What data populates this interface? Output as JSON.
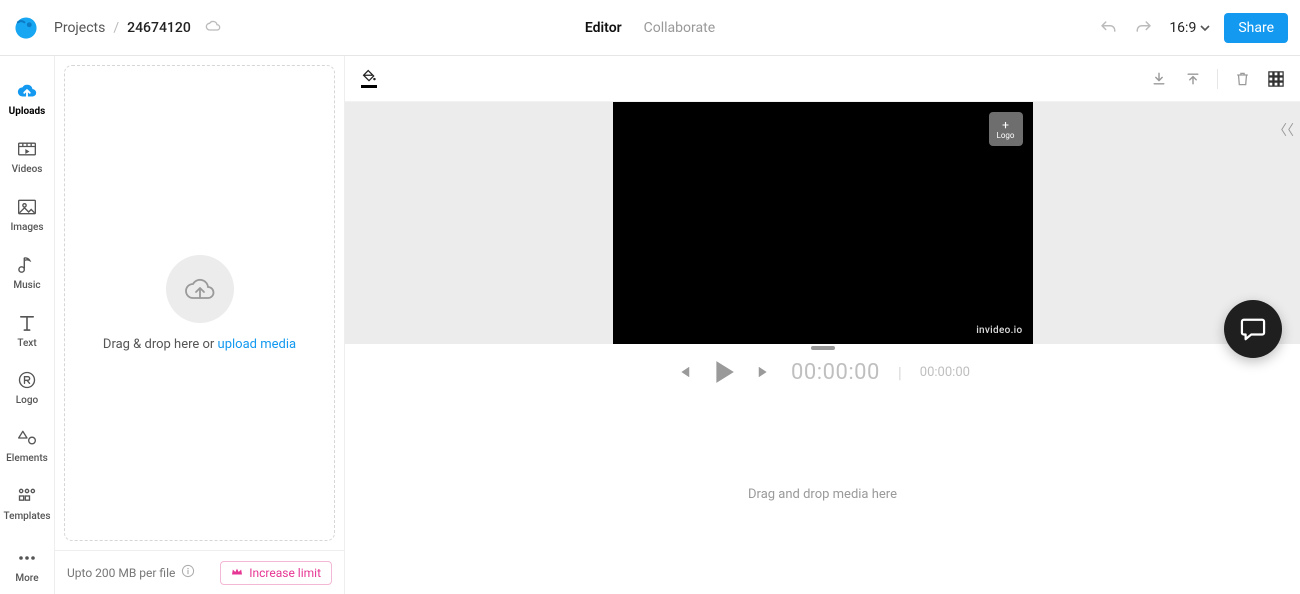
{
  "header": {
    "breadcrumb_root": "Projects",
    "breadcrumb_sep": "/",
    "project_id": "24674120",
    "tab_editor": "Editor",
    "tab_collaborate": "Collaborate",
    "aspect_ratio": "16:9",
    "share_label": "Share"
  },
  "sidebar": {
    "items": [
      {
        "label": "Uploads"
      },
      {
        "label": "Videos"
      },
      {
        "label": "Images"
      },
      {
        "label": "Music"
      },
      {
        "label": "Text"
      },
      {
        "label": "Logo"
      },
      {
        "label": "Elements"
      },
      {
        "label": "Templates"
      }
    ],
    "more_label": "More"
  },
  "uploads_panel": {
    "drop_prefix": "Drag & drop here or ",
    "drop_link": "upload media",
    "limit_note": "Upto 200 MB per file",
    "increase_label": "Increase limit"
  },
  "canvas": {
    "logo_slot_plus": "+",
    "logo_slot_label": "Logo",
    "watermark": "invideo.io"
  },
  "playback": {
    "current_time": "00:00:00",
    "total_time": "00:00:00"
  },
  "timeline": {
    "placeholder": "Drag and drop media here"
  }
}
